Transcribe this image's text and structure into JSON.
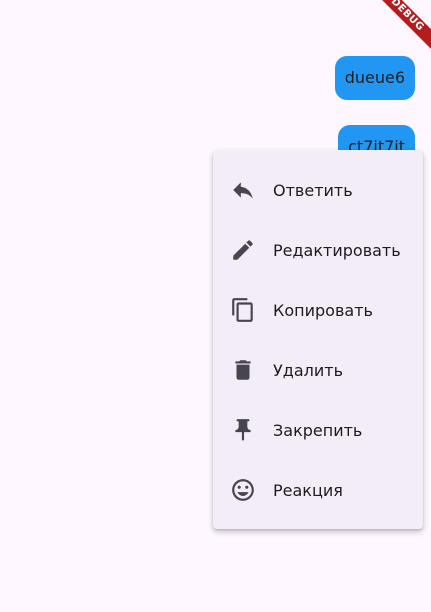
{
  "debug_banner": "DEBUG",
  "messages": [
    {
      "text": "dueue6"
    },
    {
      "text": "ct7it7it"
    }
  ],
  "context_menu": {
    "items": [
      {
        "label": "Ответить",
        "icon": "reply-icon"
      },
      {
        "label": "Редактировать",
        "icon": "edit-icon"
      },
      {
        "label": "Копировать",
        "icon": "copy-icon"
      },
      {
        "label": "Удалить",
        "icon": "delete-icon"
      },
      {
        "label": "Закрепить",
        "icon": "pin-icon"
      },
      {
        "label": "Реакция",
        "icon": "emoji-icon"
      }
    ]
  },
  "colors": {
    "background": "#fef7ff",
    "bubble": "#2196f3",
    "menu": "#f3edf7",
    "icon": "#49454f",
    "debug_banner": "#b71c1c"
  }
}
